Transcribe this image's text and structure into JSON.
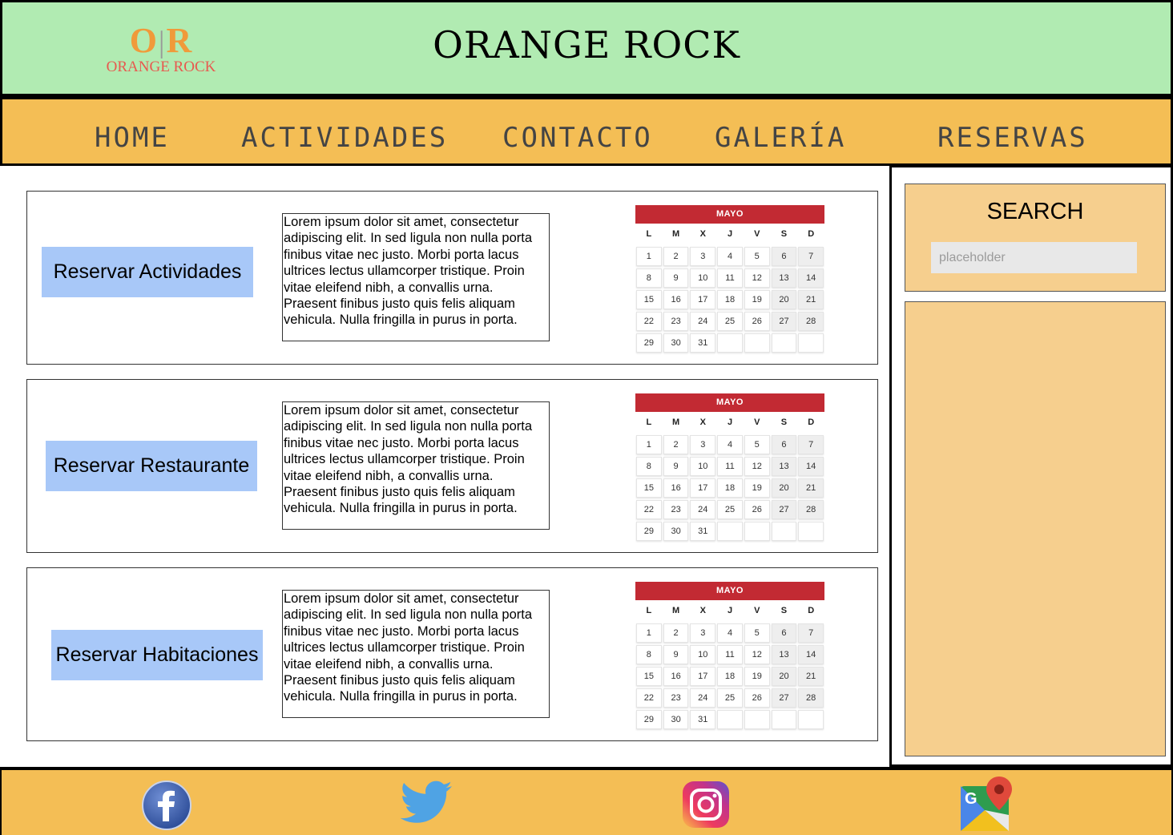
{
  "header": {
    "logo_monogram_left": "O",
    "logo_monogram_right": "R",
    "logo_name": "ORANGE ROCK",
    "title": "ORANGE ROCK"
  },
  "nav": {
    "items": [
      {
        "label": "HOME"
      },
      {
        "label": "ACTIVIDADES"
      },
      {
        "label": "CONTACTO"
      },
      {
        "label": "GALERÍA"
      },
      {
        "label": "RESERVAS"
      }
    ]
  },
  "cards": [
    {
      "button_label": "Reservar Actividades",
      "description": "Lorem ipsum dolor sit amet, consectetur adipiscing elit. In sed ligula non nulla porta finibus vitae nec justo. Morbi porta lacus ultrices lectus ullamcorper tristique. Proin vitae eleifend nibh, a convallis urna. Praesent finibus justo quis felis aliquam vehicula. Nulla fringilla in purus in porta.",
      "calendar_month": "MAYO"
    },
    {
      "button_label": "Reservar Restaurante",
      "description": "Lorem ipsum dolor sit amet, consectetur adipiscing elit. In sed ligula non nulla porta finibus vitae nec justo. Morbi porta lacus ultrices lectus ullamcorper tristique. Proin vitae eleifend nibh, a convallis urna. Praesent finibus justo quis felis aliquam vehicula. Nulla fringilla in purus in porta.",
      "calendar_month": "MAYO"
    },
    {
      "button_label": "Reservar Habitaciones",
      "description": "Lorem ipsum dolor sit amet, consectetur adipiscing elit. In sed ligula non nulla porta finibus vitae nec justo. Morbi porta lacus ultrices lectus ullamcorper tristique. Proin vitae eleifend nibh, a convallis urna. Praesent finibus justo quis felis aliquam vehicula. Nulla fringilla in purus in porta.",
      "calendar_month": "MAYO"
    }
  ],
  "calendar": {
    "weekdays": [
      "L",
      "M",
      "X",
      "J",
      "V",
      "S",
      "D"
    ],
    "weeks": [
      [
        "1",
        "2",
        "3",
        "4",
        "5",
        "6",
        "7"
      ],
      [
        "8",
        "9",
        "10",
        "11",
        "12",
        "13",
        "14"
      ],
      [
        "15",
        "16",
        "17",
        "18",
        "19",
        "20",
        "21"
      ],
      [
        "22",
        "23",
        "24",
        "25",
        "26",
        "27",
        "28"
      ],
      [
        "29",
        "30",
        "31",
        "",
        "",
        "",
        ""
      ]
    ]
  },
  "sidebar": {
    "search_title": "SEARCH",
    "search_placeholder": "placeholder"
  },
  "footer": {
    "icons": [
      "facebook-icon",
      "twitter-icon",
      "instagram-icon",
      "google-maps-icon"
    ]
  },
  "colors": {
    "header_bg": "#b1ebb2",
    "nav_bg": "#f4be55",
    "button_bg": "#a8c8f8",
    "calendar_header": "#c22a33",
    "sidebar_panel": "#f6cf8e"
  }
}
